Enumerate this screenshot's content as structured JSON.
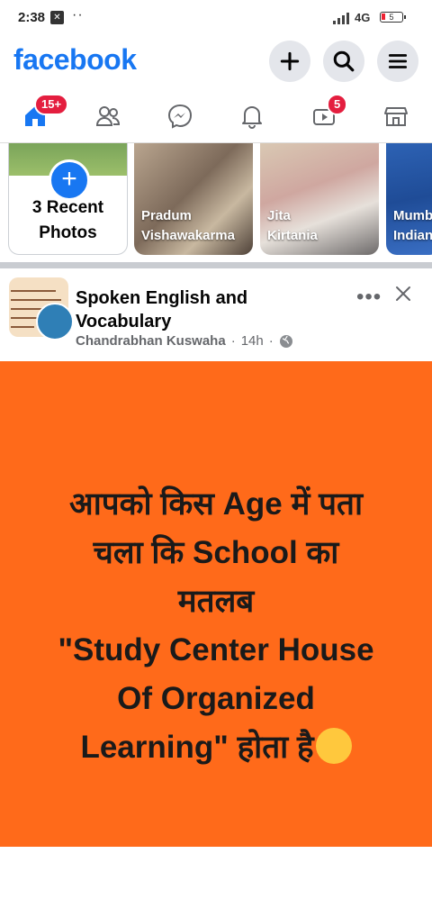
{
  "status_bar": {
    "time": "2:38",
    "dots": "··",
    "network": "4G",
    "battery": "5"
  },
  "header": {
    "logo": "facebook",
    "icons": [
      "plus-icon",
      "search-icon",
      "menu-icon"
    ]
  },
  "nav": {
    "tabs": [
      {
        "name": "home",
        "badge": "15+"
      },
      {
        "name": "friends"
      },
      {
        "name": "messenger"
      },
      {
        "name": "notifications"
      },
      {
        "name": "watch",
        "badge": "5"
      },
      {
        "name": "marketplace"
      }
    ],
    "accent": "#1877f2",
    "badge_color": "#e41e3f"
  },
  "stories": {
    "create_label": "3 Recent Photos",
    "items": [
      {
        "name": "Pradum Vishawakarma"
      },
      {
        "name": "Jita Kirtania"
      },
      {
        "name": "Mumb Indian"
      }
    ]
  },
  "post": {
    "page_name": "Spoken English and Vocabulary",
    "author": "Chandrabhan Kuswaha",
    "time": "14h",
    "sep": "·",
    "more": "•••",
    "image_bg": "#ff6a1a",
    "image_text_lines": [
      "आपको किस Age में पता",
      "चला कि School का",
      "मतलब",
      "\"Study Center House",
      "Of Organized",
      "Learning\" होता है"
    ]
  }
}
